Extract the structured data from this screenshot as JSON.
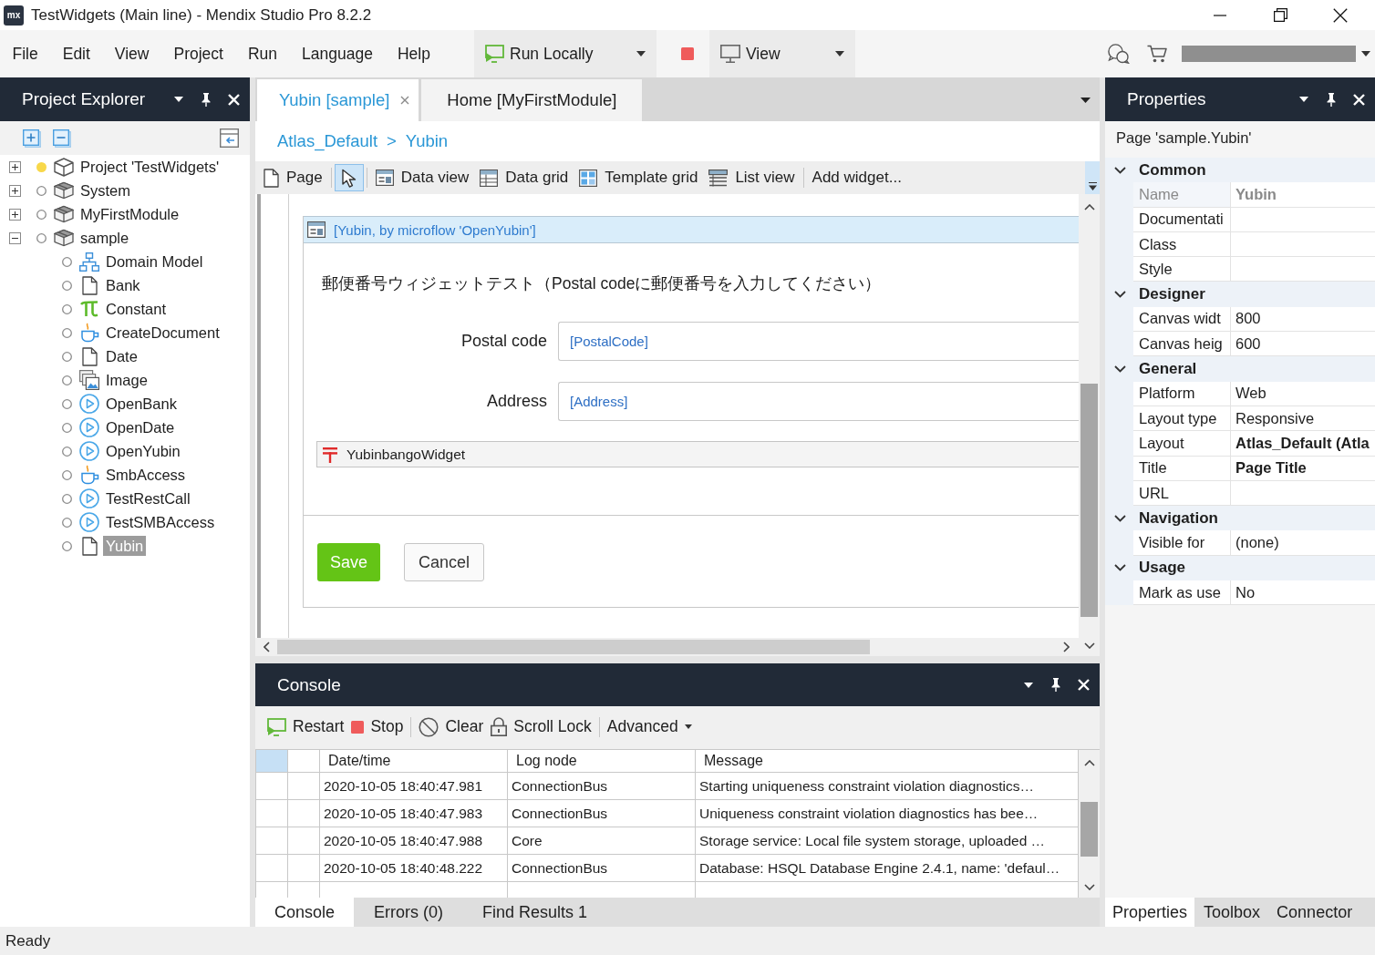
{
  "window": {
    "logo": "mx",
    "title": "TestWidgets (Main line) - Mendix Studio Pro 8.2.2"
  },
  "menu": [
    "File",
    "Edit",
    "View",
    "Project",
    "Run",
    "Language",
    "Help"
  ],
  "toolbar": {
    "run": {
      "label": "Run Locally"
    },
    "view": {
      "label": "View"
    }
  },
  "project_explorer": {
    "title": "Project Explorer",
    "tree": [
      {
        "label": "Project 'TestWidgets'",
        "kind": "project",
        "modified": true,
        "expanded": false,
        "selected": false
      },
      {
        "label": "System",
        "kind": "module",
        "modified": false,
        "expanded": false,
        "selected": false
      },
      {
        "label": "MyFirstModule",
        "kind": "module",
        "modified": false,
        "expanded": false,
        "selected": false
      },
      {
        "label": "sample",
        "kind": "module",
        "modified": false,
        "expanded": true,
        "selected": false,
        "children": [
          {
            "label": "Domain Model",
            "kind": "domain-model",
            "modified": false,
            "selected": false
          },
          {
            "label": "Bank",
            "kind": "page",
            "modified": false,
            "selected": false
          },
          {
            "label": "Constant",
            "kind": "constant",
            "modified": false,
            "selected": false
          },
          {
            "label": "CreateDocument",
            "kind": "java-action",
            "modified": false,
            "selected": false
          },
          {
            "label": "Date",
            "kind": "page",
            "modified": false,
            "selected": false
          },
          {
            "label": "Image",
            "kind": "image-collection",
            "modified": false,
            "selected": false
          },
          {
            "label": "OpenBank",
            "kind": "microflow",
            "modified": false,
            "selected": false
          },
          {
            "label": "OpenDate",
            "kind": "microflow",
            "modified": false,
            "selected": false
          },
          {
            "label": "OpenYubin",
            "kind": "microflow",
            "modified": false,
            "selected": false
          },
          {
            "label": "SmbAccess",
            "kind": "java-action",
            "modified": false,
            "selected": false
          },
          {
            "label": "TestRestCall",
            "kind": "microflow",
            "modified": false,
            "selected": false
          },
          {
            "label": "TestSMBAccess",
            "kind": "microflow",
            "modified": false,
            "selected": false
          },
          {
            "label": "Yubin",
            "kind": "page",
            "modified": false,
            "selected": true
          }
        ]
      }
    ]
  },
  "editor": {
    "tabs": [
      {
        "label": "Yubin [sample]",
        "selected": true
      },
      {
        "label": "Home [MyFirstModule]",
        "selected": false
      }
    ],
    "breadcrumb": {
      "items": [
        "Atlas_Default",
        "Yubin"
      ],
      "separator": ">"
    },
    "widget_toolbar": [
      [
        {
          "kind": "page",
          "label": "Page",
          "selected": false
        }
      ],
      [
        {
          "kind": "pointer",
          "selected": true
        }
      ],
      [
        {
          "kind": "data-view",
          "label": "Data view",
          "selected": false
        },
        {
          "kind": "data-grid",
          "label": "Data grid",
          "selected": false
        },
        {
          "kind": "template-grid",
          "label": "Template grid",
          "selected": false
        },
        {
          "kind": "list-view",
          "label": "List view",
          "selected": false
        }
      ],
      [
        {
          "kind": "text",
          "label": "Add widget...",
          "selected": false
        }
      ]
    ],
    "page": {
      "data_view": {
        "source": "[Yubin, by microflow 'OpenYubin']",
        "intro": "郵便番号ウィジェットテスト（Postal codeに郵便番号を入力してください）",
        "fields": [
          {
            "label": "Postal code",
            "value": "[PostalCode]"
          },
          {
            "label": "Address",
            "value": "[Address]"
          }
        ],
        "widget": {
          "label": "YubinbangoWidget"
        },
        "buttons": [
          {
            "label": "Save",
            "kind": "primary"
          },
          {
            "label": "Cancel",
            "kind": "default"
          }
        ]
      }
    }
  },
  "console": {
    "title": "Console",
    "toolbar": [
      [
        {
          "kind": "restart",
          "label": "Restart"
        },
        {
          "kind": "stop",
          "label": "Stop"
        }
      ],
      [
        {
          "kind": "clear",
          "label": "Clear"
        },
        {
          "kind": "lock",
          "label": "Scroll Lock"
        }
      ],
      [
        {
          "kind": "menu",
          "label": "Advanced"
        }
      ]
    ],
    "columns": [
      "Date/time",
      "Log node",
      "Message"
    ],
    "rows": [
      {
        "time": "2020-10-05 18:40:47.981",
        "node": "ConnectionBus",
        "message": "Starting uniqueness constraint violation diagnostics…",
        "selected": false
      },
      {
        "time": "2020-10-05 18:40:47.983",
        "node": "ConnectionBus",
        "message": "Uniqueness constraint violation diagnostics has bee…",
        "selected": false
      },
      {
        "time": "2020-10-05 18:40:47.988",
        "node": "Core",
        "message": "Storage service: Local file system storage, uploaded …",
        "selected": false
      },
      {
        "time": "2020-10-05 18:40:48.222",
        "node": "ConnectionBus",
        "message": "Database: HSQL Database Engine 2.4.1, name: 'defaul…",
        "selected": false
      }
    ],
    "tabs": [
      {
        "label": "Console",
        "selected": true
      },
      {
        "label": "Errors (0)",
        "selected": false
      },
      {
        "label": "Find Results 1",
        "selected": false
      }
    ]
  },
  "properties": {
    "title": "Properties",
    "subject": "Page 'sample.Yubin'",
    "sections": [
      {
        "title": "Common",
        "expanded": true,
        "rows": [
          {
            "label": "Name",
            "value": "Yubin",
            "disabled": true,
            "bold": true
          },
          {
            "label": "Documentati",
            "disabled": false,
            "bold": false
          },
          {
            "label": "Class",
            "disabled": false,
            "bold": false
          },
          {
            "label": "Style",
            "disabled": false,
            "bold": false
          }
        ]
      },
      {
        "title": "Designer",
        "expanded": true,
        "rows": [
          {
            "label": "Canvas widt",
            "value": "800",
            "disabled": false,
            "bold": false
          },
          {
            "label": "Canvas heig",
            "value": "600",
            "disabled": false,
            "bold": false
          }
        ]
      },
      {
        "title": "General",
        "expanded": true,
        "rows": [
          {
            "label": "Platform",
            "value": "Web",
            "disabled": false,
            "bold": false
          },
          {
            "label": "Layout type",
            "value": "Responsive",
            "disabled": false,
            "bold": false
          },
          {
            "label": "Layout",
            "value": "Atlas_Default (Atla",
            "disabled": false,
            "bold": true
          },
          {
            "label": "Title",
            "value": "Page Title",
            "disabled": false,
            "bold": true
          },
          {
            "label": "URL",
            "disabled": false,
            "bold": false
          }
        ]
      },
      {
        "title": "Navigation",
        "expanded": true,
        "rows": [
          {
            "label": "Visible for",
            "value": "(none)",
            "disabled": false,
            "bold": false
          }
        ]
      },
      {
        "title": "Usage",
        "expanded": true,
        "rows": [
          {
            "label": "Mark as use",
            "value": "No",
            "disabled": false,
            "bold": false
          }
        ]
      }
    ],
    "tabs": [
      {
        "label": "Properties",
        "selected": true
      },
      {
        "label": "Toolbox",
        "selected": false
      },
      {
        "label": "Connector",
        "selected": false
      }
    ]
  },
  "status_bar": {
    "text": "Ready"
  }
}
